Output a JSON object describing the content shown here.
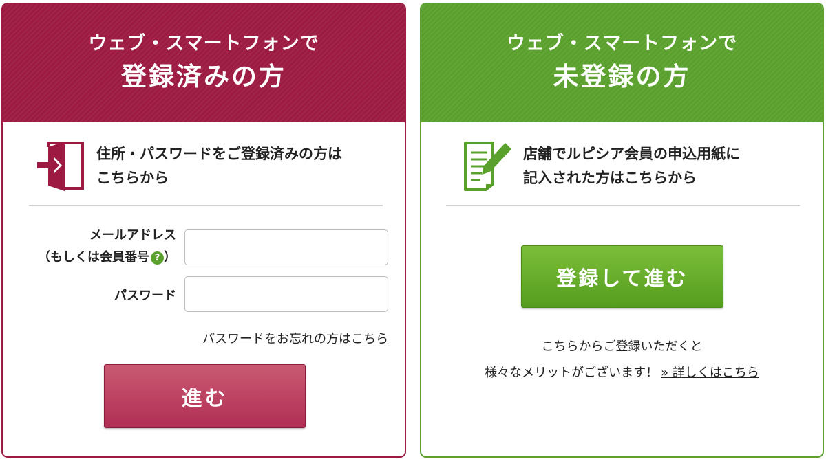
{
  "registered": {
    "header_sub": "ウェブ・スマートフォンで",
    "header_main": "登録済みの方",
    "intro_line1": "住所・パスワードをご登録済みの方は",
    "intro_line2": "こちらから",
    "icon": "door-enter-icon",
    "email_label_line1": "メールアドレス",
    "email_label_open": "（もしくは会員番号",
    "email_label_close": "）",
    "help_icon_glyph": "?",
    "email_value": "",
    "password_label": "パスワード",
    "password_value": "",
    "forgot_password_link": "パスワードをお忘れの方はこちら",
    "proceed_button": "進む",
    "accent_color": "#9d1a42"
  },
  "unregistered": {
    "header_sub": "ウェブ・スマートフォンで",
    "header_main": "未登録の方",
    "intro_line1": "店舗でルピシア会員の申込用紙に",
    "intro_line2": "記入された方はこちらから",
    "icon": "form-pencil-icon",
    "register_button": "登録して進む",
    "merit_line1": "こちらからご登録いただくと",
    "merit_line2": "様々なメリットがございます！",
    "details_link": "» 詳しくはこちら",
    "accent_color": "#5aa02c"
  }
}
